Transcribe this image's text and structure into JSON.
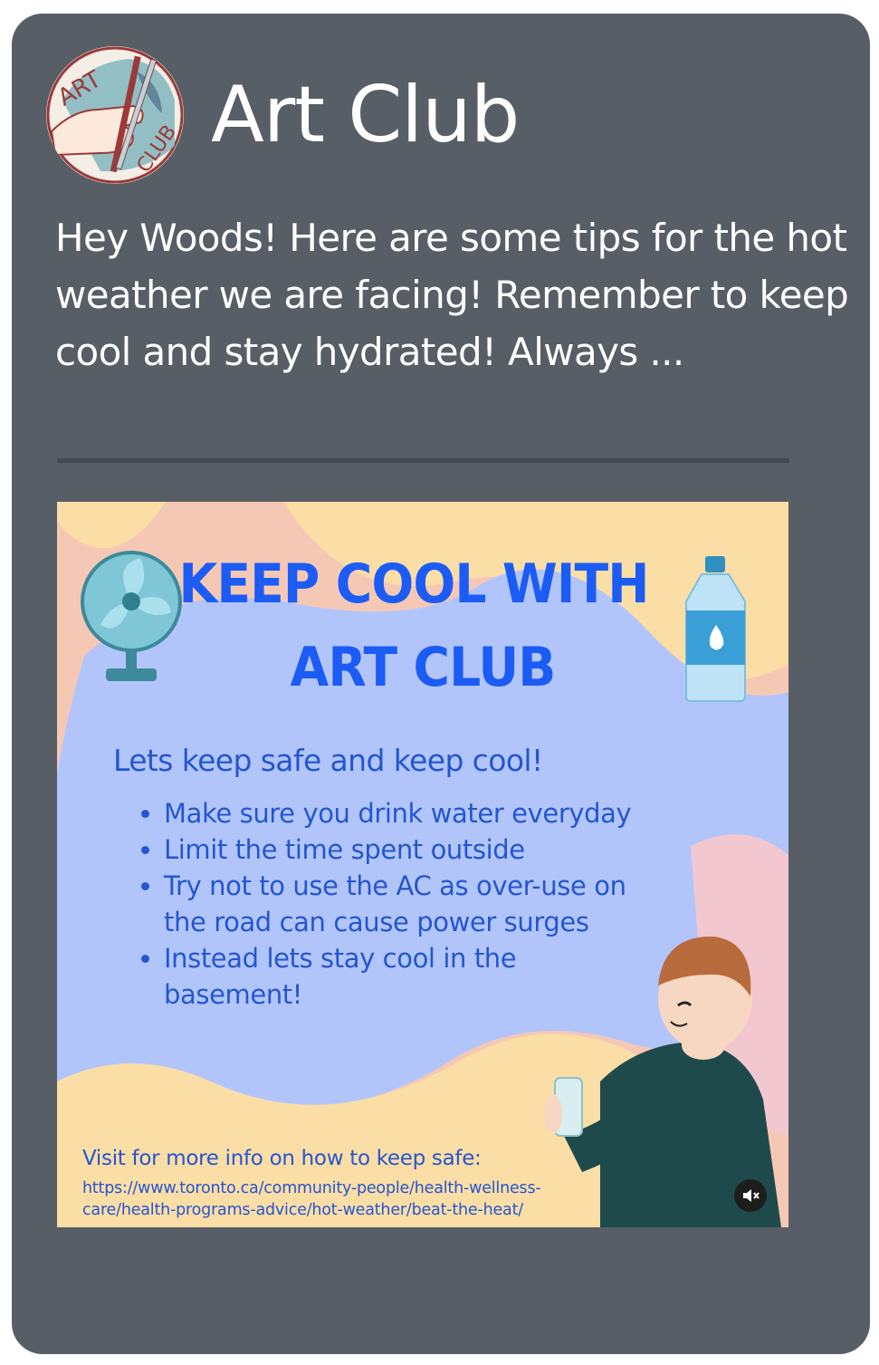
{
  "post": {
    "author": "Art Club",
    "logo_text": [
      "ART",
      "CLUB"
    ],
    "caption": "Hey Woods! Here are some tips for the hot weather we are facing! Remember to keep cool and stay hydrated! Always ..."
  },
  "poster": {
    "heading_line1": "KEEP COOL WITH",
    "heading_line2": "ART CLUB",
    "subheading": "Lets keep safe and keep cool!",
    "tips": [
      "Make sure you drink water everyday",
      "Limit the time spent outside",
      "Try not to use the AC as over-use on the road can cause power surges",
      "Instead lets stay cool in the basement!"
    ],
    "visit_text": "Visit for more info on how to keep safe:",
    "url": "https://www.toronto.ca/community-people/health-wellness-care/health-programs-advice/hot-weather/beat-the-heat/"
  },
  "icons": {
    "logo": "hand-holding-pencils-logo",
    "fan": "desk-fan-icon",
    "bottle": "water-bottle-icon",
    "person": "person-drinking-water-illustration",
    "mute": "muted-speaker-icon"
  },
  "colors": {
    "card_bg": "#575e66",
    "poster_blue": "#1c5cf5",
    "poster_pink": "#f5c8b5",
    "poster_yellow": "#fbdda6",
    "poster_lavender": "#b2c5fb"
  }
}
